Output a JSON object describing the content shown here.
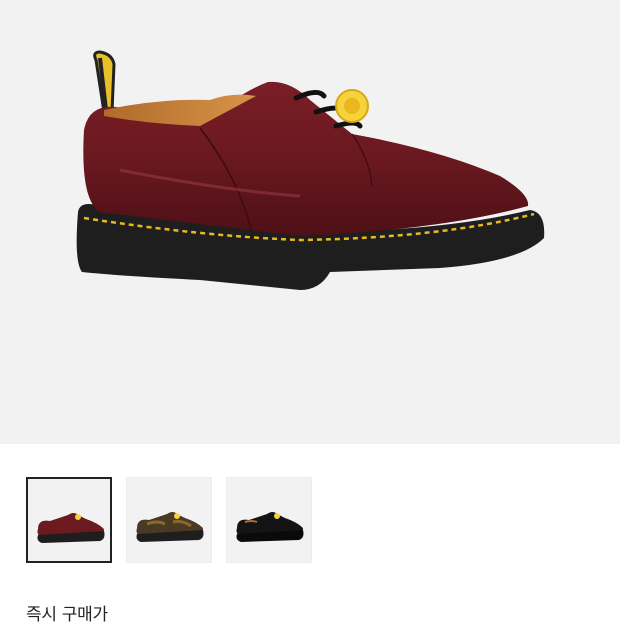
{
  "product": {
    "main_image": "shoe-burgundy-main",
    "thumbnails": [
      {
        "name": "shoe-burgundy-thumbnail",
        "selected": true,
        "upper_color": "#6b1a1f"
      },
      {
        "name": "shoe-brown-camo-thumbnail",
        "selected": false,
        "upper_color": "#4a3a24"
      },
      {
        "name": "shoe-black-thumbnail",
        "selected": false,
        "upper_color": "#141414"
      }
    ],
    "price_label": "즉시 구매가"
  },
  "colors": {
    "hero_bg": "#f2f2f2",
    "stitch": "#e8b81e",
    "badge": "#f5d33a"
  }
}
